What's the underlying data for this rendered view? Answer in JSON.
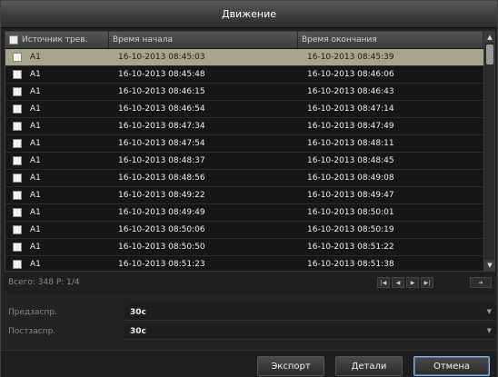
{
  "dialog": {
    "title": "Движение"
  },
  "table": {
    "headers": {
      "source": "Источник трев.",
      "start": "Время начала",
      "end": "Время окончания"
    },
    "rows": [
      {
        "source": "A1",
        "start": "16-10-2013 08:45:03",
        "end": "16-10-2013 08:45:39",
        "selected": true
      },
      {
        "source": "A1",
        "start": "16-10-2013 08:45:48",
        "end": "16-10-2013 08:46:06",
        "selected": false
      },
      {
        "source": "A1",
        "start": "16-10-2013 08:46:15",
        "end": "16-10-2013 08:46:43",
        "selected": false
      },
      {
        "source": "A1",
        "start": "16-10-2013 08:46:54",
        "end": "16-10-2013 08:47:14",
        "selected": false
      },
      {
        "source": "A1",
        "start": "16-10-2013 08:47:34",
        "end": "16-10-2013 08:47:49",
        "selected": false
      },
      {
        "source": "A1",
        "start": "16-10-2013 08:47:54",
        "end": "16-10-2013 08:48:11",
        "selected": false
      },
      {
        "source": "A1",
        "start": "16-10-2013 08:48:37",
        "end": "16-10-2013 08:48:45",
        "selected": false
      },
      {
        "source": "A1",
        "start": "16-10-2013 08:48:56",
        "end": "16-10-2013 08:49:08",
        "selected": false
      },
      {
        "source": "A1",
        "start": "16-10-2013 08:49:22",
        "end": "16-10-2013 08:49:47",
        "selected": false
      },
      {
        "source": "A1",
        "start": "16-10-2013 08:49:49",
        "end": "16-10-2013 08:50:01",
        "selected": false
      },
      {
        "source": "A1",
        "start": "16-10-2013 08:50:06",
        "end": "16-10-2013 08:50:19",
        "selected": false
      },
      {
        "source": "A1",
        "start": "16-10-2013 08:50:50",
        "end": "16-10-2013 08:51:22",
        "selected": false
      },
      {
        "source": "A1",
        "start": "16-10-2013 08:51:23",
        "end": "16-10-2013 08:51:38",
        "selected": false
      }
    ]
  },
  "pager": {
    "summary": "Всего: 348  P: 1/4",
    "icons": [
      "first-page-icon",
      "prev-page-icon",
      "next-page-icon",
      "last-page-icon",
      "go-to-page-icon"
    ]
  },
  "fields": {
    "pre_record": {
      "label": "Предзаспр.",
      "value": "30с"
    },
    "post_record": {
      "label": "Постзаспр.",
      "value": "30с"
    }
  },
  "buttons": {
    "export": "Экспорт",
    "details": "Детали",
    "cancel": "Отмена"
  },
  "colors": {
    "selected_row": "#a8a58a",
    "cancel_focus": "#8fb0d8"
  }
}
